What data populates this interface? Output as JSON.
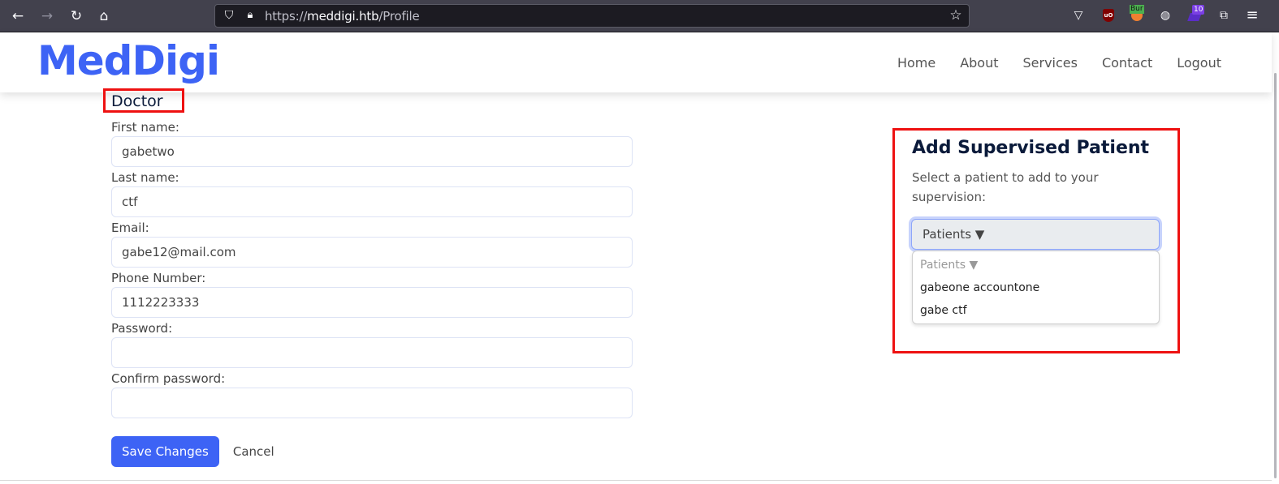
{
  "browser": {
    "url_scheme": "https://",
    "url_host": "meddigi.htb",
    "url_path": "/Profile",
    "icons": {
      "back": "←",
      "forward": "→",
      "reload": "↻",
      "home": "⌂",
      "shield": "⛉",
      "lock": "🔒︎",
      "star": "☆",
      "pocket": "▽",
      "ublock": "uO",
      "burp_badge": "Bur",
      "cookie": "◍",
      "ext_badge": "10",
      "extensions": "⧉",
      "menu": "≡"
    }
  },
  "header": {
    "logo": "MedDigi",
    "nav": [
      "Home",
      "About",
      "Services",
      "Contact",
      "Logout"
    ]
  },
  "profile": {
    "role": "Doctor",
    "fields": [
      {
        "label": "First name:",
        "value": "gabetwo",
        "type": "text"
      },
      {
        "label": "Last name:",
        "value": "ctf",
        "type": "text"
      },
      {
        "label": "Email:",
        "value": "gabe12@mail.com",
        "type": "email"
      },
      {
        "label": "Phone Number:",
        "value": "1112223333",
        "type": "text"
      },
      {
        "label": "Password:",
        "value": "",
        "type": "password"
      },
      {
        "label": "Confirm password:",
        "value": "",
        "type": "password"
      }
    ],
    "save_label": "Save Changes",
    "cancel_label": "Cancel"
  },
  "supervise": {
    "title": "Add Supervised Patient",
    "description": "Select a patient to add to your supervision:",
    "select_value": "Patients ▼",
    "options": [
      "Patients ▼",
      "gabeone accountone",
      "gabe ctf"
    ]
  },
  "colors": {
    "brand": "#3d63f5",
    "highlight_box": "#ee1111",
    "heading": "#0a1a3a"
  }
}
